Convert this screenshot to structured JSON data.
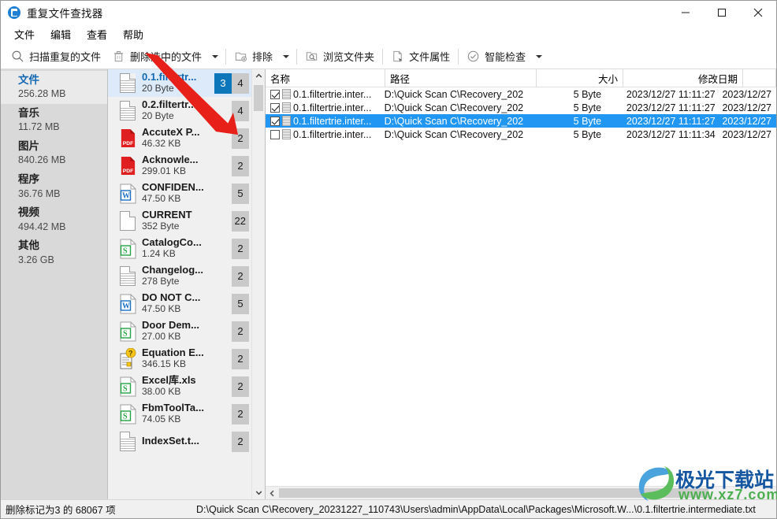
{
  "window": {
    "title": "重复文件查找器",
    "icon": "app-icon",
    "controls": {
      "minimize": "—",
      "maximize": "□",
      "close": "✕"
    }
  },
  "menu": {
    "items": [
      {
        "label": "文件"
      },
      {
        "label": "编辑"
      },
      {
        "label": "查看"
      },
      {
        "label": "帮助"
      }
    ]
  },
  "toolbar": {
    "buttons": [
      {
        "label": "扫描重复的文件",
        "icon": "search-icon",
        "caret": false
      },
      {
        "label": "删除选中的文件",
        "icon": "trash-icon",
        "caret": true
      },
      {
        "label": "排除",
        "icon": "exclude-folder-icon",
        "caret": true
      },
      {
        "label": "浏览文件夹",
        "icon": "browse-folder-icon",
        "caret": false
      },
      {
        "label": "文件属性",
        "icon": "file-properties-icon",
        "caret": false
      },
      {
        "label": "智能检查",
        "icon": "smart-check-icon",
        "caret": true
      }
    ]
  },
  "sidebar": {
    "items": [
      {
        "label": "文件",
        "size": "256.28 MB",
        "active": true
      },
      {
        "label": "音乐",
        "size": "11.72 MB",
        "active": false
      },
      {
        "label": "图片",
        "size": "840.26 MB",
        "active": false
      },
      {
        "label": "程序",
        "size": "36.76 MB",
        "active": false
      },
      {
        "label": "視频",
        "size": "494.42 MB",
        "active": false
      },
      {
        "label": "其他",
        "size": "3.26 GB",
        "active": false
      }
    ]
  },
  "grouplist": {
    "rows": [
      {
        "name": "0.1.filtertr...",
        "size": "20 Byte",
        "icon": "text-file-icon",
        "badge_blue": "3",
        "badge_gray": "4",
        "selected": true
      },
      {
        "name": "0.2.filtertr...",
        "size": "20 Byte",
        "icon": "text-file-icon",
        "badge_blue": "",
        "badge_gray": "4",
        "selected": false
      },
      {
        "name": "AccuteX P...",
        "size": "46.32 KB",
        "icon": "pdf-file-icon",
        "badge_blue": "",
        "badge_gray": "2",
        "selected": false
      },
      {
        "name": "Acknowle...",
        "size": "299.01 KB",
        "icon": "pdf-file-icon",
        "badge_blue": "",
        "badge_gray": "2",
        "selected": false
      },
      {
        "name": "CONFIDEN...",
        "size": "47.50 KB",
        "icon": "word-file-icon",
        "badge_blue": "",
        "badge_gray": "5",
        "selected": false
      },
      {
        "name": "CURRENT",
        "size": "352 Byte",
        "icon": "blank-file-icon",
        "badge_blue": "",
        "badge_gray": "22",
        "selected": false
      },
      {
        "name": "CatalogCo...",
        "size": "1.24 KB",
        "icon": "spreadsheet-file-icon",
        "badge_blue": "",
        "badge_gray": "2",
        "selected": false
      },
      {
        "name": "Changelog...",
        "size": "278 Byte",
        "icon": "text-file-icon",
        "badge_blue": "",
        "badge_gray": "2",
        "selected": false
      },
      {
        "name": "DO NOT C...",
        "size": "47.50 KB",
        "icon": "word-file-icon",
        "badge_blue": "",
        "badge_gray": "5",
        "selected": false
      },
      {
        "name": "Door Dem...",
        "size": "27.00 KB",
        "icon": "spreadsheet-file-icon",
        "badge_blue": "",
        "badge_gray": "2",
        "selected": false
      },
      {
        "name": "Equation E...",
        "size": "346.15 KB",
        "icon": "unknown-file-icon",
        "badge_blue": "",
        "badge_gray": "2",
        "selected": false
      },
      {
        "name": "Excel库.xls",
        "size": "38.00 KB",
        "icon": "spreadsheet-file-icon",
        "badge_blue": "",
        "badge_gray": "2",
        "selected": false
      },
      {
        "name": "FbmToolTa...",
        "size": "74.05 KB",
        "icon": "spreadsheet-file-icon",
        "badge_blue": "",
        "badge_gray": "2",
        "selected": false
      },
      {
        "name": "IndexSet.t...",
        "size": "",
        "icon": "text-file-icon",
        "badge_blue": "",
        "badge_gray": "2",
        "selected": false
      }
    ]
  },
  "details": {
    "columns": [
      {
        "label": "名称",
        "align": "left",
        "width": 152
      },
      {
        "label": "路径",
        "align": "left",
        "width": 192
      },
      {
        "label": "大小",
        "align": "right",
        "width": 110
      },
      {
        "label": "修改日期",
        "align": "right",
        "width": 152
      },
      {
        "label": "",
        "align": "right",
        "width": 90
      }
    ],
    "rows": [
      {
        "checked": true,
        "selected": false,
        "name": "0.1.filtertrie.inter...",
        "path": "D:\\Quick Scan C\\Recovery_202...",
        "size": "5 Byte",
        "modified": "2023/12/27 11:11:27",
        "extra": "2023/12/27"
      },
      {
        "checked": true,
        "selected": false,
        "name": "0.1.filtertrie.inter...",
        "path": "D:\\Quick Scan C\\Recovery_202...",
        "size": "5 Byte",
        "modified": "2023/12/27 11:11:27",
        "extra": "2023/12/27"
      },
      {
        "checked": true,
        "selected": true,
        "name": "0.1.filtertrie.inter...",
        "path": "D:\\Quick Scan C\\Recovery_202...",
        "size": "5 Byte",
        "modified": "2023/12/27 11:11:27",
        "extra": "2023/12/27"
      },
      {
        "checked": false,
        "selected": false,
        "name": "0.1.filtertrie.inter...",
        "path": "D:\\Quick Scan C\\Recovery_202...",
        "size": "5 Byte",
        "modified": "2023/12/27 11:11:34",
        "extra": "2023/12/27"
      }
    ]
  },
  "statusbar": {
    "left": "删除标记为3 的 68067 项",
    "right": "D:\\Quick Scan C\\Recovery_20231227_110743\\Users\\admin\\AppData\\Local\\Packages\\Microsoft.W...\\0.1.filtertrie.intermediate.txt"
  },
  "watermark": {
    "title": "极光下载站",
    "url": "www.xz7.com"
  },
  "colors": {
    "accent_blue": "#0b76ba",
    "row_selected": "#2196f3",
    "group_selected": "#dceafa",
    "sidebar_bg": "#d9d9d9",
    "annotation_red": "#e8201a"
  }
}
